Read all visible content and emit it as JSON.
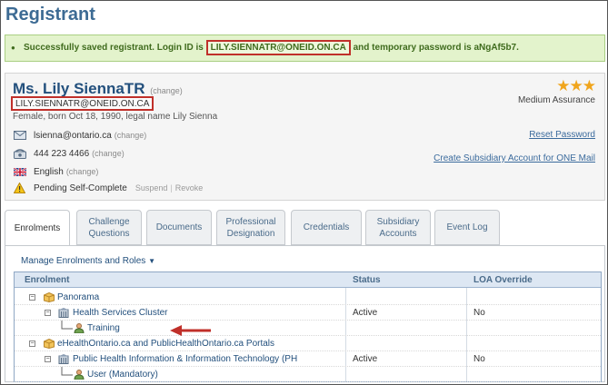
{
  "page": {
    "title": "Registrant"
  },
  "success_banner": {
    "text_before": "Successfully saved registrant. Login ID is ",
    "login_id": "LILY.SIENNATR@ONEID.ON.CA",
    "text_after": " and temporary password is aNgAf5b7.",
    "colors": {
      "background": "#e3f3cc",
      "text": "#3f6b1d",
      "highlight_border": "#c0302a"
    }
  },
  "profile": {
    "name": "Ms. Lily SiennaTR",
    "change_label": "(change)",
    "login_id": "LILY.SIENNATR@ONEID.ON.CA",
    "meta": "Female, born Oct 18, 1990, legal name Lily Sienna",
    "assurance_level": "Medium Assurance",
    "stars_count": 3,
    "email": {
      "value": "lsienna@ontario.ca",
      "change": "(change)",
      "icon": "envelope-icon"
    },
    "phone": {
      "value": "444 223 4466",
      "change": "(change)",
      "icon": "phone-icon"
    },
    "language": {
      "value": "English",
      "change": "(change)",
      "icon": "uk-flag-icon"
    },
    "status": {
      "value": "Pending Self-Complete",
      "suspend": "Suspend",
      "separator": "|",
      "revoke": "Revoke",
      "icon": "warning-icon"
    },
    "reset_password": "Reset Password",
    "create_subsidiary": "Create Subsidiary Account for ONE Mail"
  },
  "tabs": [
    {
      "label": "Enrolments",
      "active": true
    },
    {
      "label": "Challenge Questions",
      "active": false
    },
    {
      "label": "Documents",
      "active": false
    },
    {
      "label": "Professional Designation",
      "active": false
    },
    {
      "label": "Credentials",
      "active": false
    },
    {
      "label": "Subsidiary Accounts",
      "active": false
    },
    {
      "label": "Event Log",
      "active": false
    }
  ],
  "enrolments": {
    "manage_label": "Manage Enrolments and Roles",
    "manage_icon": "caret-down-icon",
    "columns": [
      "Enrolment",
      "Status",
      "LOA Override"
    ],
    "rows": [
      {
        "label": "Panorama",
        "icon": "package-icon",
        "status": "",
        "loa": ""
      },
      {
        "label": "Health Services Cluster",
        "icon": "building-icon",
        "status": "Active",
        "loa": "No"
      },
      {
        "label": "Training",
        "icon": "user-role-icon",
        "status": "",
        "loa": ""
      },
      {
        "label": "eHealthOntario.ca and PublicHealthOntario.ca Portals",
        "icon": "package-icon",
        "status": "",
        "loa": ""
      },
      {
        "label": "Public Health Information & Information Technology (PH",
        "icon": "building-icon",
        "status": "Active",
        "loa": "No"
      },
      {
        "label": "User (Mandatory)",
        "icon": "user-role-icon",
        "status": "",
        "loa": ""
      }
    ]
  },
  "annotation": {
    "icon": "red-arrow-icon",
    "color": "#c0302a"
  }
}
